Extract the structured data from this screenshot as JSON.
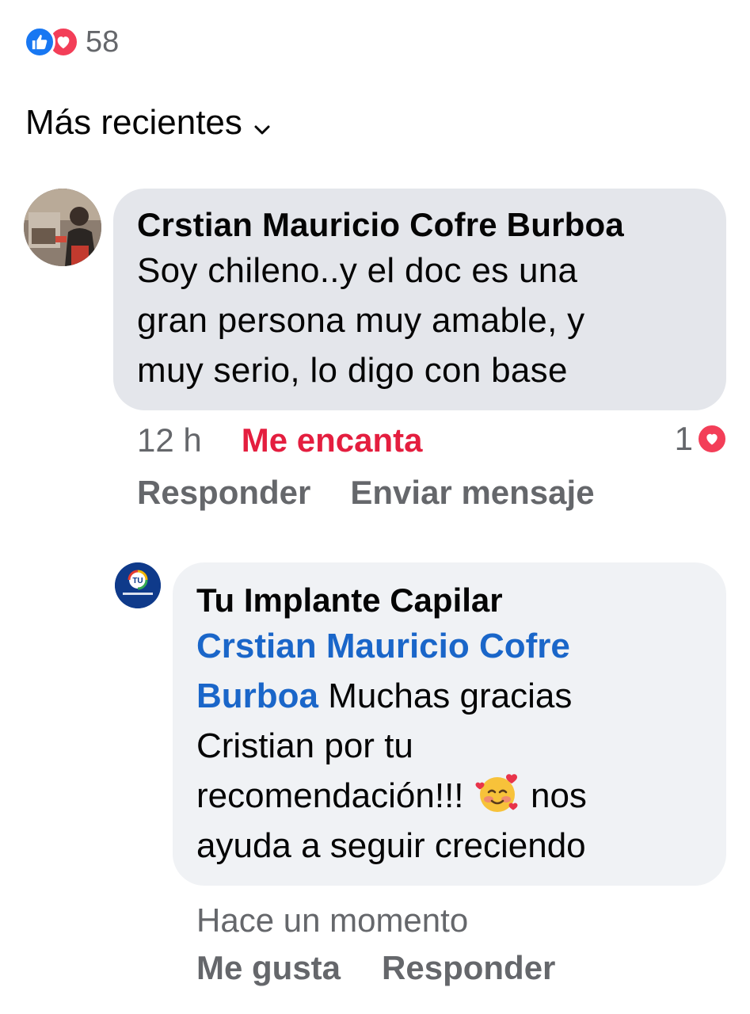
{
  "reactions": {
    "count": "58",
    "types": [
      "like-icon",
      "love-icon"
    ]
  },
  "sort": {
    "label": "Más recientes"
  },
  "comment": {
    "author": "Crstian Mauricio Cofre Burboa",
    "lines": [
      "Soy chileno..y el doc es una",
      "gran persona muy amable, y",
      "muy serio, lo digo con base"
    ],
    "time": "12 h",
    "reaction_label": "Me encanta",
    "love_count": "1",
    "reply_label": "Responder",
    "message_label": "Enviar mensaje"
  },
  "reply": {
    "author": "Tu Implante Capilar",
    "avatar_text": "TU",
    "mention_line1": "Crstian Mauricio Cofre",
    "mention_line2": "Burboa",
    "text_after_mention": " Muchas gracias",
    "line3": "Cristian por tu",
    "line4_before_emoji": "recomendación!!! ",
    "line4_after_emoji": " nos",
    "line5": "ayuda a seguir creciendo",
    "time": "Hace un momento",
    "like_label": "Me gusta",
    "reply_label": "Responder"
  },
  "colors": {
    "like_blue": "#1877f2",
    "love_red": "#f33e58",
    "reaction_text": "#e41e3f",
    "mention_blue": "#1a66c9",
    "bubble_gray": "#e4e6eb",
    "bubble_light": "#f0f2f5",
    "meta_gray": "#65676b"
  }
}
